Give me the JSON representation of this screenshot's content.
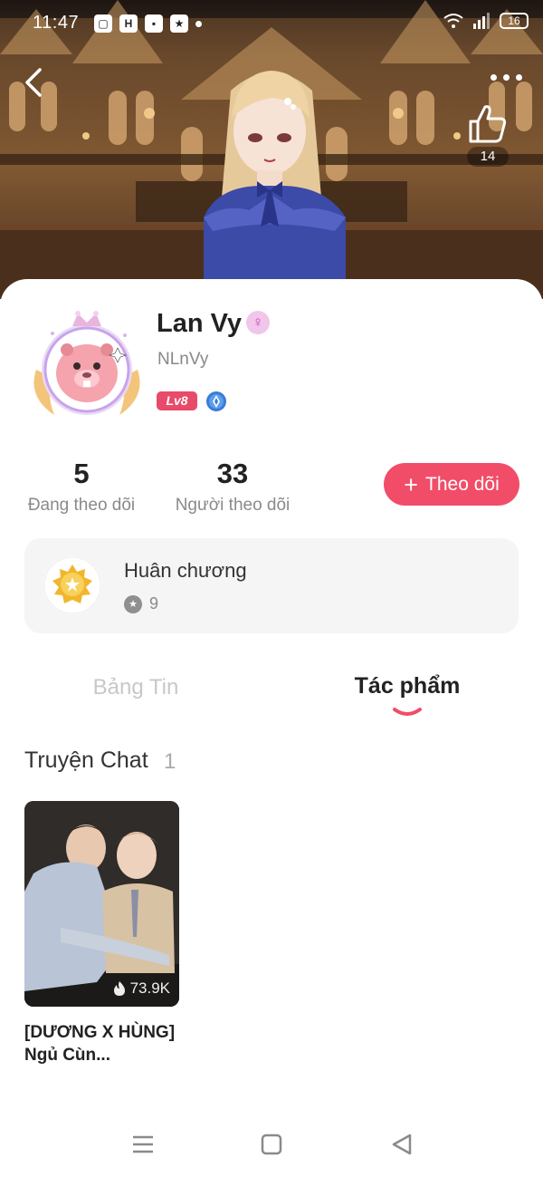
{
  "status_bar": {
    "time": "11:47",
    "battery": "16",
    "app_icons": [
      "H",
      "★"
    ]
  },
  "header": {
    "like_count": "14"
  },
  "profile": {
    "name": "Lan Vy",
    "gender_symbol": "♀",
    "username": "NLnVy",
    "level": "Lv8"
  },
  "stats": {
    "following_count": "5",
    "following_label": "Đang theo dõi",
    "followers_count": "33",
    "followers_label": "Người theo dõi"
  },
  "follow_button": {
    "plus": "+",
    "label": "Theo dõi"
  },
  "medals": {
    "title": "Huân chương",
    "count": "9"
  },
  "tabs": [
    {
      "label": "Bảng Tin",
      "active": false
    },
    {
      "label": "Tác phẩm",
      "active": true
    }
  ],
  "section": {
    "title": "Truyện Chat",
    "count": "1"
  },
  "stories": [
    {
      "title": "[DƯƠNG X HÙNG] Ngủ Cùn...",
      "views": "73.9K"
    }
  ],
  "colors": {
    "accent": "#f14d68",
    "level_badge": "#e84a6a",
    "card_background": "#f5f5f5",
    "muted_text": "#8a8a8a"
  },
  "icons": {
    "back": "chevron-left-icon",
    "more": "more-dots-icon",
    "like": "thumbs-up-icon",
    "gender": "female-icon",
    "badge": "diamond-badge-icon",
    "medal": "medal-icon",
    "views": "flame-icon",
    "nav": [
      "menu-icon",
      "home-square-icon",
      "back-triangle-icon"
    ]
  }
}
